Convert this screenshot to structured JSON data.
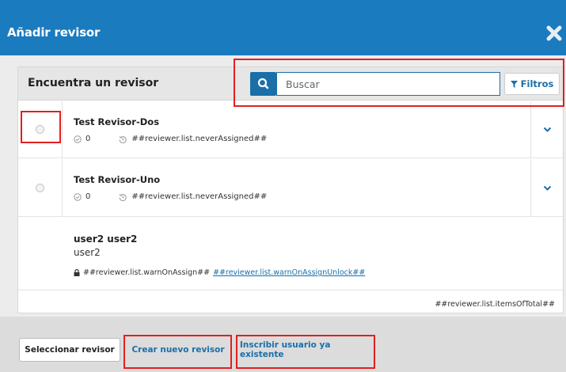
{
  "modal": {
    "title": "Añadir revisor",
    "close_icon": "close-icon"
  },
  "panel": {
    "title": "Encuentra un revisor",
    "search_placeholder": "Buscar",
    "filters_label": "Filtros"
  },
  "reviewers": [
    {
      "name": "Test Revisor-Dos",
      "count": "0",
      "note": "##reviewer.list.neverAssigned##"
    },
    {
      "name": "Test Revisor-Uno",
      "count": "0",
      "note": "##reviewer.list.neverAssigned##"
    }
  ],
  "user": {
    "fullname": "user2 user2",
    "username": "user2",
    "warning": "##reviewer.list.warnOnAssign##",
    "unlock_link": "##reviewer.list.warnOnAssignUnlock##"
  },
  "list_total": "##reviewer.list.itemsOfTotal##",
  "footer": {
    "select_label": "Seleccionar revisor",
    "create_label": "Crear nuevo revisor",
    "enroll_label": "Inscribir usuario ya existente"
  },
  "colors": {
    "header": "#1a7bbf",
    "accent": "#1a6fa8",
    "highlight": "#e02020"
  }
}
